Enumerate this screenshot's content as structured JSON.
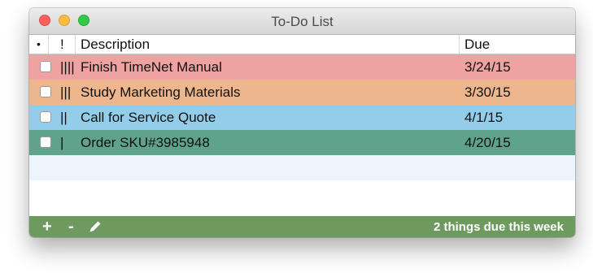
{
  "window": {
    "title": "To-Do List"
  },
  "columns": {
    "done": "•",
    "priority": "!",
    "description": "Description",
    "due": "Due"
  },
  "tasks": [
    {
      "priority": "||||",
      "description": "Finish TimeNet Manual",
      "due": "3/24/15",
      "color": "#eea3a2",
      "done": false
    },
    {
      "priority": "|||",
      "description": "Study Marketing Materials",
      "due": "3/30/15",
      "color": "#eeb68c",
      "done": false
    },
    {
      "priority": "||",
      "description": "Call for Service Quote",
      "due": "4/1/15",
      "color": "#93cdea",
      "done": false
    },
    {
      "priority": "|",
      "description": "Order SKU#3985948",
      "due": "4/20/15",
      "color": "#5fa38d",
      "done": false
    }
  ],
  "toolbar": {
    "add_label": "+",
    "remove_label": "-",
    "edit_icon": "pencil-icon",
    "status": "2 things due this week",
    "color": "#6e9a60"
  }
}
